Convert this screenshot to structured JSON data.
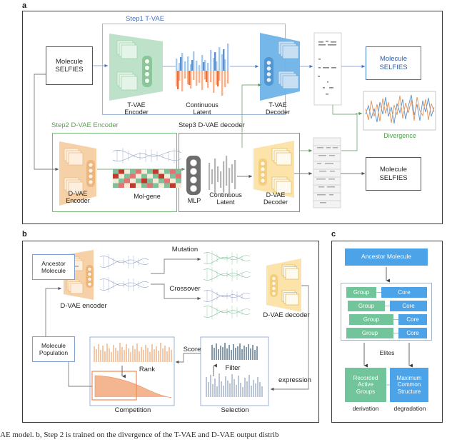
{
  "figure": {
    "panels": [
      "a",
      "b",
      "c"
    ],
    "caption": "AE model. b, Step 2 is trained on the divergence of the T-VAE and D-VAE output distrib"
  },
  "panel_a": {
    "letter": "a",
    "groups": [
      {
        "label": "Step1 T-VAE",
        "color": "#4472c4"
      },
      {
        "label": "Step2 D-VAE Encoder",
        "color": "#5a9e52"
      },
      {
        "label": "Step3 D-VAE decoder",
        "color": "#262626"
      }
    ],
    "input_box": "Molecule\nSELFIES",
    "tvae_encoder": "T-VAE\nEncoder",
    "continuous_latent_1": "Continuous\nLatent",
    "tvae_decoder": "T-VAE\nDecoder",
    "output_box_top": "Molecule\nSELFIES",
    "divergence_label": "Divergence",
    "dvae_encoder": "D-VAE\nEncoder",
    "mol_gene": "Mol-gene",
    "mlp": "MLP",
    "continuous_latent_2": "Continuous\nLatent",
    "dvae_decoder": "D-VAE\nDecoder",
    "output_box_bottom": "Molecule\nSELFIES"
  },
  "panel_b": {
    "letter": "b",
    "ancestor_molecule": "Ancestor\nMolecule",
    "dvae_encoder": "D-VAE encoder",
    "mutation": "Mutation",
    "crossover": "Crossover",
    "dvae_decoder": "D-VAE decoder",
    "expression": "expression",
    "selection": "Selection",
    "filter": "Filter",
    "score": "Score",
    "competition": "Competition",
    "rank": "Rank",
    "molecule_population": "Molecule\nPopulation"
  },
  "panel_c": {
    "letter": "c",
    "ancestor": "Ancestor Molecule",
    "pairs": [
      {
        "group": "Group",
        "core": "Core"
      },
      {
        "group": "Group",
        "core": "Core"
      },
      {
        "group": "Group",
        "core": "Core"
      },
      {
        "group": "Group",
        "core": "Core"
      }
    ],
    "elites": "Elites",
    "outcome_left": "Recorded\nActive\nGroups",
    "outcome_right": "Maximum\nCommon\nStructure",
    "label_left": "derivation",
    "label_right": "degradation"
  },
  "colors": {
    "blue_accent": "#4472c4",
    "green_accent": "#5a9e52",
    "green_fill": "#b6dfc0",
    "orange_fill": "#f5c99a",
    "yellow_fill": "#fbe3a8",
    "blue_fill": "#6fb3e8",
    "c_blue": "#4da3e8",
    "c_green": "#72c49a",
    "border_dark": "#3a3a3a"
  }
}
